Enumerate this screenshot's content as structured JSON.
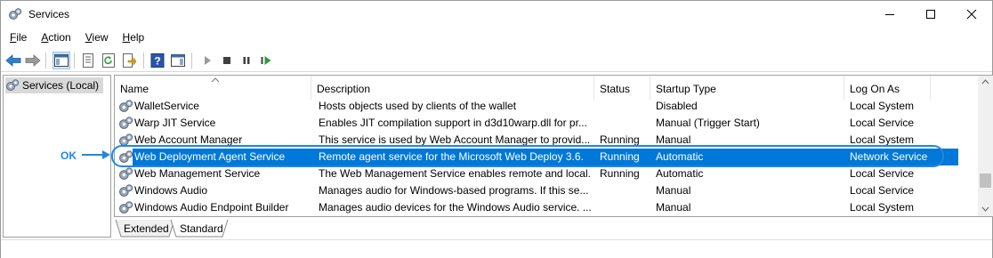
{
  "window": {
    "title": "Services"
  },
  "menu": [
    {
      "key": "F",
      "rest": "ile"
    },
    {
      "key": "A",
      "rest": "ction"
    },
    {
      "key": "V",
      "rest": "iew"
    },
    {
      "key": "H",
      "rest": "elp"
    }
  ],
  "tree": {
    "root_label": "Services (Local)"
  },
  "columns": [
    "Name",
    "Description",
    "Status",
    "Startup Type",
    "Log On As"
  ],
  "rows": [
    {
      "name": "WalletService",
      "description": "Hosts objects used by clients of the wallet",
      "status": "",
      "startup": "Disabled",
      "logon": "Local System"
    },
    {
      "name": "Warp JIT Service",
      "description": "Enables JIT compilation support in d3d10warp.dll for pr...",
      "status": "",
      "startup": "Manual (Trigger Start)",
      "logon": "Local Service"
    },
    {
      "name": "Web Account Manager",
      "description": "This service is used by Web Account Manager to provid...",
      "status": "Running",
      "startup": "Manual",
      "logon": "Local System"
    },
    {
      "name": "Web Deployment Agent Service",
      "description": "Remote agent service for the Microsoft Web Deploy 3.6.",
      "status": "Running",
      "startup": "Automatic",
      "logon": "Network Service"
    },
    {
      "name": "Web Management Service",
      "description": "The Web Management Service enables remote and local...",
      "status": "Running",
      "startup": "Automatic",
      "logon": "Local Service"
    },
    {
      "name": "Windows Audio",
      "description": "Manages audio for Windows-based programs.  If this se...",
      "status": "",
      "startup": "Manual",
      "logon": "Local Service"
    },
    {
      "name": "Windows Audio Endpoint Builder",
      "description": "Manages audio devices for the Windows Audio service. ...",
      "status": "",
      "startup": "Manual",
      "logon": "Local System"
    }
  ],
  "tabs": [
    "Extended",
    "Standard"
  ],
  "annotation": {
    "label": "OK",
    "color": "#1e88e5"
  },
  "colors": {
    "selection": "#0078d7"
  }
}
